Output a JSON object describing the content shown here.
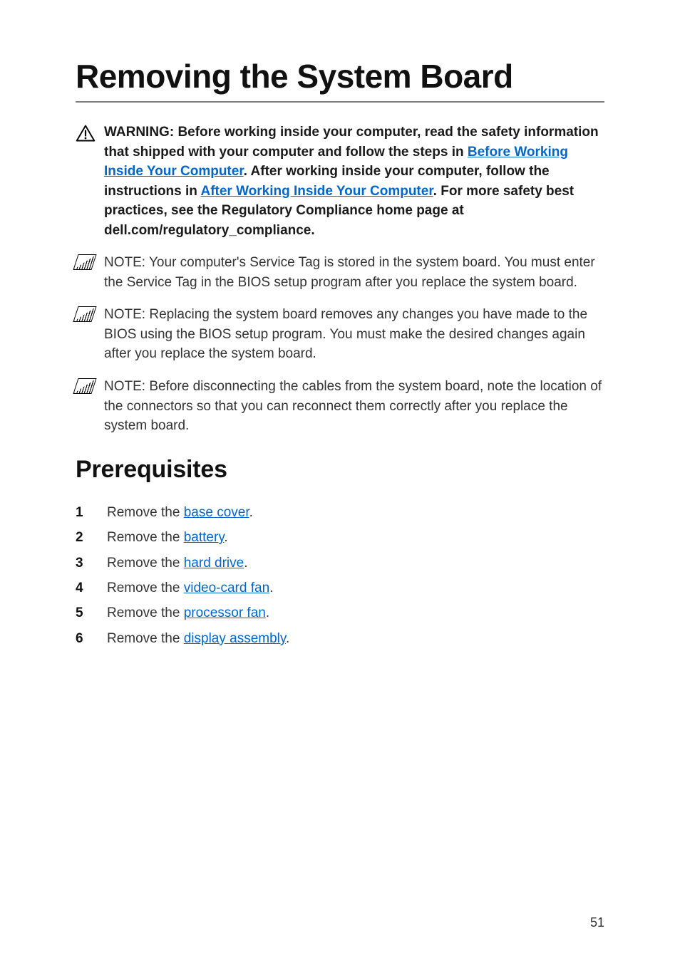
{
  "title": "Removing the System Board",
  "warning": {
    "prefix": "WARNING: ",
    "t1": "Before working inside your computer, read the safety information that shipped with your computer and follow the steps in ",
    "link1": "Before Working Inside Your Computer",
    "t2": ". After working inside your computer, follow the instructions in ",
    "link2": "After Working Inside Your Computer",
    "t3": ". For more safety best practices, see the Regulatory Compliance home page at dell.com/regulatory_compliance."
  },
  "notes": [
    {
      "prefix": "NOTE: ",
      "text": "Your computer's Service Tag is stored in the system board. You must enter the Service Tag in the BIOS setup program after you replace the system board."
    },
    {
      "prefix": "NOTE: ",
      "text": "Replacing the system board removes any changes you have made to the BIOS using the BIOS setup program. You must make the desired changes again after you replace the system board."
    },
    {
      "prefix": "NOTE: ",
      "text": "Before disconnecting the cables from the system board, note the location of the connectors so that you can reconnect them correctly after you replace the system board."
    }
  ],
  "section": "Prerequisites",
  "steps": [
    {
      "pre": "Remove the ",
      "link": "base cover",
      "post": "."
    },
    {
      "pre": "Remove the ",
      "link": "battery",
      "post": "."
    },
    {
      "pre": "Remove the ",
      "link": "hard drive",
      "post": "."
    },
    {
      "pre": "Remove the ",
      "link": "video-card fan",
      "post": "."
    },
    {
      "pre": "Remove the ",
      "link": "processor fan",
      "post": "."
    },
    {
      "pre": "Remove the ",
      "link": "display assembly",
      "post": "."
    }
  ],
  "page_number": "51"
}
